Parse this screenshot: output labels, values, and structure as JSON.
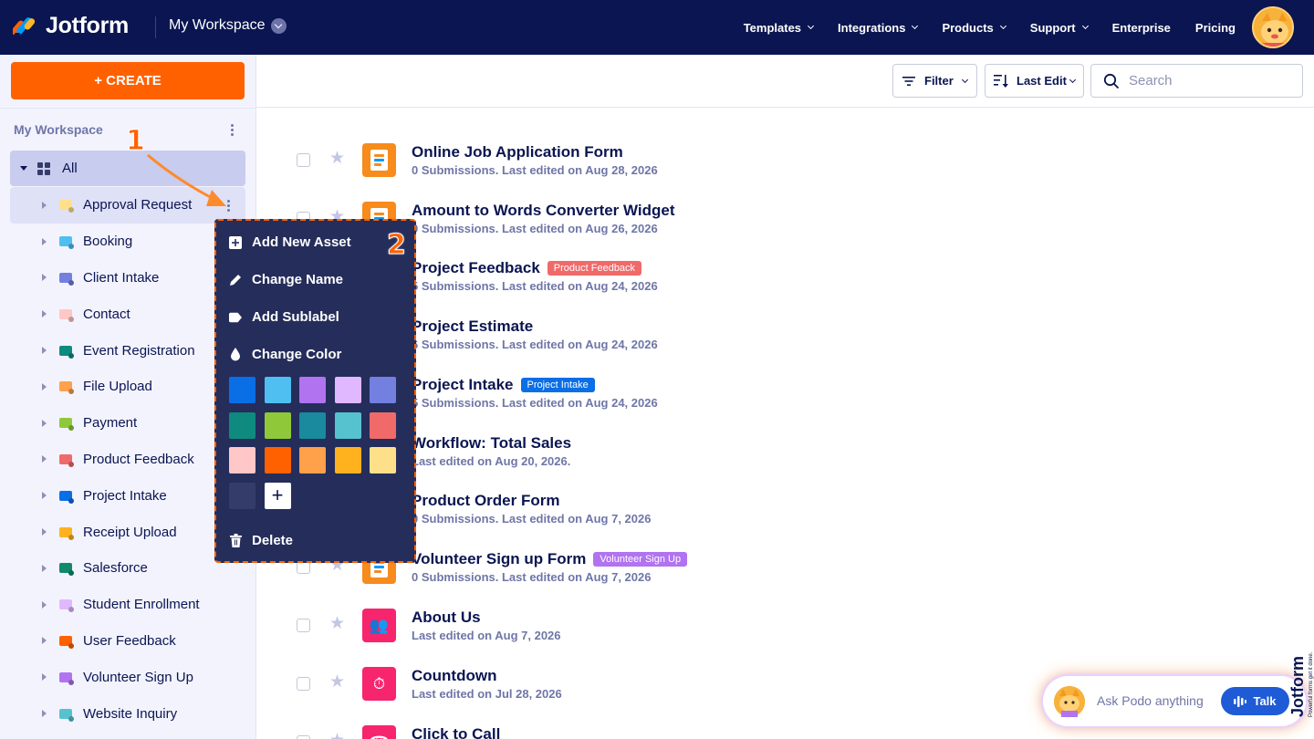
{
  "topnav": {
    "logo_text": "Jotform",
    "workspace_title": "My Workspace",
    "items": [
      {
        "label": "Templates",
        "dropdown": true
      },
      {
        "label": "Integrations",
        "dropdown": true
      },
      {
        "label": "Products",
        "dropdown": true
      },
      {
        "label": "Support",
        "dropdown": true
      },
      {
        "label": "Enterprise",
        "dropdown": false
      },
      {
        "label": "Pricing",
        "dropdown": false
      }
    ]
  },
  "sidebar": {
    "create_label": "+ CREATE",
    "title": "My Workspace",
    "all_label": "All",
    "folders": [
      {
        "label": "Approval Request",
        "color": "#ffe08a"
      },
      {
        "label": "Booking",
        "color": "#4fbff2"
      },
      {
        "label": "Client Intake",
        "color": "#7380e0"
      },
      {
        "label": "Contact",
        "color": "#ffc7c7"
      },
      {
        "label": "Event Registration",
        "color": "#0f8a7e"
      },
      {
        "label": "File Upload",
        "color": "#ffa04a"
      },
      {
        "label": "Payment",
        "color": "#8fc93a"
      },
      {
        "label": "Product Feedback",
        "color": "#f06a6a"
      },
      {
        "label": "Project Intake",
        "color": "#0a6ee6"
      },
      {
        "label": "Receipt Upload",
        "color": "#ffb21e"
      },
      {
        "label": "Salesforce",
        "color": "#0f8a6a"
      },
      {
        "label": "Student Enrollment",
        "color": "#e0b8ff"
      },
      {
        "label": "User Feedback",
        "color": "#ff6100"
      },
      {
        "label": "Volunteer Sign Up",
        "color": "#b173f0"
      },
      {
        "label": "Website Inquiry",
        "color": "#56c2cf"
      }
    ]
  },
  "toolbar": {
    "filter_label": "Filter",
    "sort_label": "Last Edit",
    "search_placeholder": "Search"
  },
  "forms": [
    {
      "title": "Online Job Application Form",
      "subtitle": "0 Submissions. Last edited on Aug 28, 2026",
      "kind": "form",
      "tag": null
    },
    {
      "title": "Amount to Words Converter Widget",
      "subtitle": "0 Submissions. Last edited on Aug 26, 2026",
      "kind": "form",
      "tag": null
    },
    {
      "title": "Project Feedback",
      "subtitle": "5 Submissions. Last edited on Aug 24, 2026",
      "kind": "form",
      "tag": {
        "label": "Product Feedback",
        "color": "#f06a6a"
      }
    },
    {
      "title": "Project Estimate",
      "subtitle": "6 Submissions. Last edited on Aug 24, 2026",
      "kind": "form",
      "tag": null
    },
    {
      "title": "Project Intake",
      "subtitle": "5 Submissions. Last edited on Aug 24, 2026",
      "kind": "form",
      "tag": {
        "label": "Project Intake",
        "color": "#0a6ee6"
      }
    },
    {
      "title": "Workflow: Total Sales",
      "subtitle": "Last edited on Aug 20, 2026.",
      "kind": "form",
      "tag": null
    },
    {
      "title": "Product Order Form",
      "subtitle": "0 Submissions. Last edited on Aug 7, 2026",
      "kind": "form",
      "tag": null
    },
    {
      "title": "Volunteer Sign up Form",
      "subtitle": "0 Submissions. Last edited on Aug 7, 2026",
      "kind": "form",
      "tag": {
        "label": "Volunteer Sign Up",
        "color": "#b173f0"
      }
    },
    {
      "title": "About Us",
      "subtitle": "Last edited on Aug 7, 2026",
      "kind": "app-people",
      "tag": null
    },
    {
      "title": "Countdown",
      "subtitle": "Last edited on Jul 28, 2026",
      "kind": "app-timer",
      "tag": null
    },
    {
      "title": "Click to Call",
      "subtitle": "",
      "kind": "app-phone",
      "tag": null
    }
  ],
  "context_menu": {
    "add_asset": "Add New Asset",
    "change_name": "Change Name",
    "add_sublabel": "Add Sublabel",
    "change_color": "Change Color",
    "delete": "Delete",
    "swatches": [
      "#0a6ee6",
      "#4fbff2",
      "#b173f0",
      "#e0b8ff",
      "#7380e0",
      "#0f8a7e",
      "#8fc93a",
      "#1a8a9e",
      "#56c2cf",
      "#f06a6a",
      "#ffc7c7",
      "#ff6100",
      "#ffa04a",
      "#ffb21e",
      "#ffe08a",
      "#343c6a"
    ]
  },
  "annotations": {
    "step1": "1",
    "step2": "2"
  },
  "podo": {
    "placeholder": "Ask Podo anything",
    "talk_label": "Talk"
  },
  "brand": {
    "vertical": "Jotform",
    "tagline": "Powerful forms get it done."
  }
}
